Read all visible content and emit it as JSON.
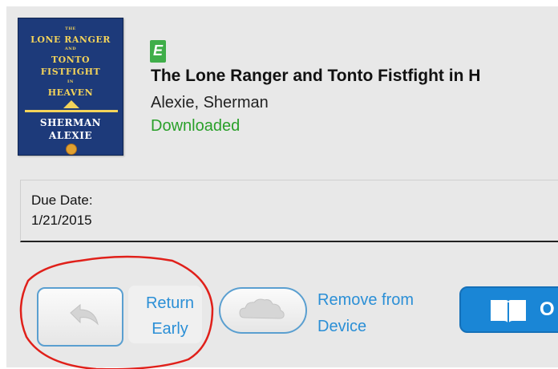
{
  "book": {
    "cover": {
      "title_line1": "LONE RANGER",
      "title_and": "AND",
      "title_line2": "TONTO",
      "title_line3": "FISTFIGHT",
      "title_in": "IN",
      "title_line4": "HEAVEN",
      "author_line1": "SHERMAN",
      "author_line2": "ALEXIE",
      "colors": {
        "background": "#1d3a7a",
        "title_text": "#f3d35a"
      }
    },
    "format_icon": "ebook-icon",
    "format_glyph": "E",
    "title": "The Lone Ranger and Tonto Fistfight in H",
    "author": "Alexie, Sherman",
    "status": "Downloaded"
  },
  "due": {
    "label": "Due Date:",
    "value": "1/21/2015"
  },
  "actions": {
    "return_icon": "return-arrow-icon",
    "return_label_1": "Return",
    "return_label_2": "Early",
    "remove_icon": "cloud-icon",
    "remove_label_1": "Remove from",
    "remove_label_2": "Device",
    "open_icon": "open-book-icon",
    "open_label": "O"
  },
  "colors": {
    "accent_blue": "#2b8fd6",
    "status_green": "#2aa02a",
    "annotation_red": "#e0201a"
  }
}
